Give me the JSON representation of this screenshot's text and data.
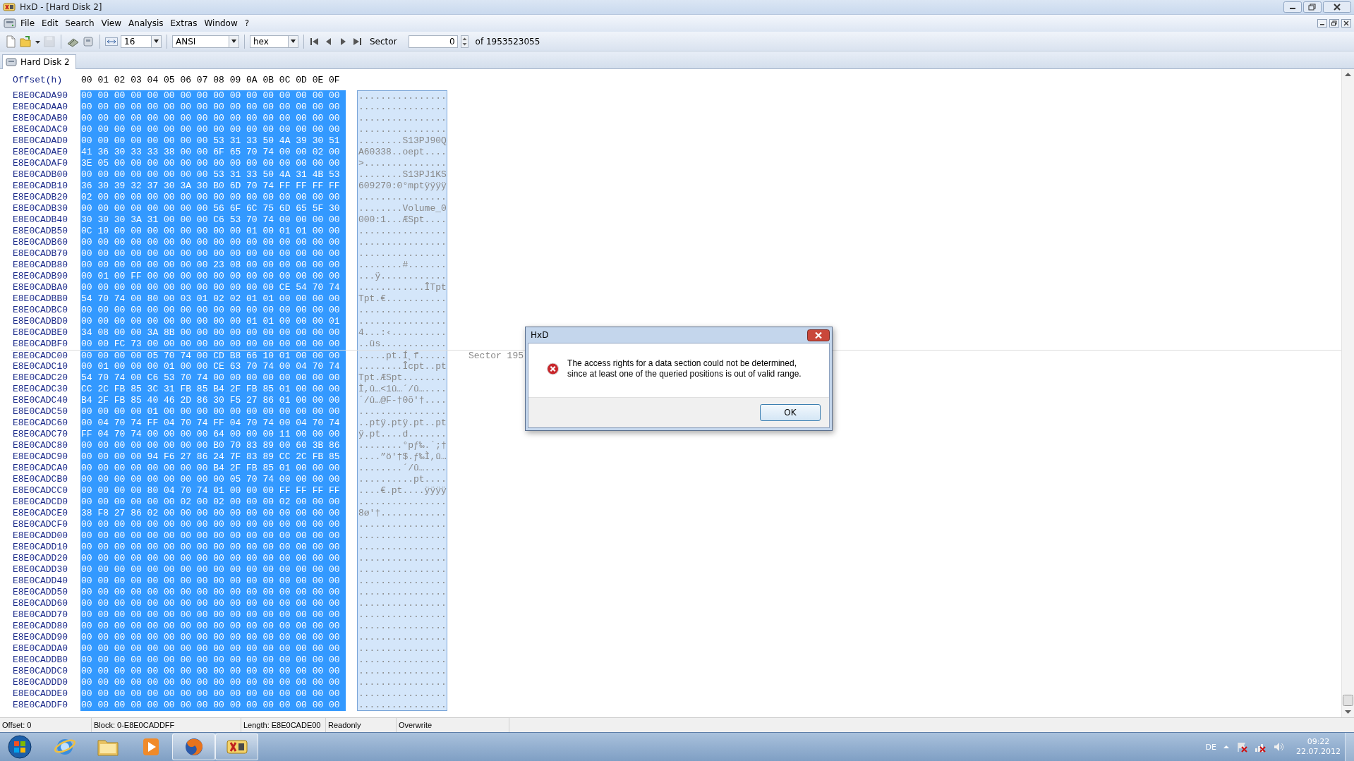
{
  "window": {
    "title": "HxD - [Hard Disk 2]"
  },
  "menu": [
    "File",
    "Edit",
    "Search",
    "View",
    "Analysis",
    "Extras",
    "Window",
    "?"
  ],
  "toolbar": {
    "buttons": [
      {
        "kind": "new",
        "disabled": false
      },
      {
        "kind": "open",
        "disabled": false
      },
      {
        "kind": "save",
        "disabled": true
      },
      {
        "kind": "ram",
        "disabled": false
      },
      {
        "kind": "disk",
        "disabled": false
      }
    ],
    "bytes_per_row": "16",
    "charset": "ANSI",
    "number_base": "hex",
    "nav": [
      {
        "kind": "first"
      },
      {
        "kind": "prev"
      },
      {
        "kind": "next"
      },
      {
        "kind": "last"
      }
    ],
    "sector_label": "Sector",
    "sector_value": "0",
    "sector_total": "of 1953523055"
  },
  "tabs": [
    {
      "label": "Hard Disk 2",
      "selected": true
    }
  ],
  "editor": {
    "offset_heading": "Offset(h)",
    "columns": [
      "00",
      "01",
      "02",
      "03",
      "04",
      "05",
      "06",
      "07",
      "08",
      "09",
      "0A",
      "0B",
      "0C",
      "0D",
      "0E",
      "0F"
    ],
    "hex_selected": true,
    "rows": [
      {
        "offset": "E8E0CADA90",
        "hex": "00 00 00 00 00 00 00 00 00 00 00 00 00 00 00 00",
        "text": "................"
      },
      {
        "offset": "E8E0CADAA0",
        "hex": "00 00 00 00 00 00 00 00 00 00 00 00 00 00 00 00",
        "text": "................"
      },
      {
        "offset": "E8E0CADAB0",
        "hex": "00 00 00 00 00 00 00 00 00 00 00 00 00 00 00 00",
        "text": "................"
      },
      {
        "offset": "E8E0CADAC0",
        "hex": "00 00 00 00 00 00 00 00 00 00 00 00 00 00 00 00",
        "text": "................"
      },
      {
        "offset": "E8E0CADAD0",
        "hex": "00 00 00 00 00 00 00 00 53 31 33 50 4A 39 30 51",
        "text": "........S13PJ90Q"
      },
      {
        "offset": "E8E0CADAE0",
        "hex": "41 36 30 33 33 38 00 00 6F 65 70 74 00 00 02 00",
        "text": "A60338..oept...."
      },
      {
        "offset": "E8E0CADAF0",
        "hex": "3E 05 00 00 00 00 00 00 00 00 00 00 00 00 00 00",
        "text": ">..............."
      },
      {
        "offset": "E8E0CADB00",
        "hex": "00 00 00 00 00 00 00 00 53 31 33 50 4A 31 4B 53",
        "text": "........S13PJ1KS"
      },
      {
        "offset": "E8E0CADB10",
        "hex": "36 30 39 32 37 30 3A 30 B0 6D 70 74 FF FF FF FF",
        "text": "609270:0°mptÿÿÿÿ"
      },
      {
        "offset": "E8E0CADB20",
        "hex": "02 00 00 00 00 00 00 00 00 00 00 00 00 00 00 00",
        "text": "................"
      },
      {
        "offset": "E8E0CADB30",
        "hex": "00 00 00 00 00 00 00 00 56 6F 6C 75 6D 65 5F 30",
        "text": "........Volume_0"
      },
      {
        "offset": "E8E0CADB40",
        "hex": "30 30 30 3A 31 00 00 00 C6 53 70 74 00 00 00 00",
        "text": "000:1...ÆSpt...."
      },
      {
        "offset": "E8E0CADB50",
        "hex": "0C 10 00 00 00 00 00 00 00 00 01 00 01 01 00 00",
        "text": "................"
      },
      {
        "offset": "E8E0CADB60",
        "hex": "00 00 00 00 00 00 00 00 00 00 00 00 00 00 00 00",
        "text": "................"
      },
      {
        "offset": "E8E0CADB70",
        "hex": "00 00 00 00 00 00 00 00 00 00 00 00 00 00 00 00",
        "text": "................"
      },
      {
        "offset": "E8E0CADB80",
        "hex": "00 00 00 00 00 00 00 00 23 08 00 00 00 00 00 00",
        "text": "........#......."
      },
      {
        "offset": "E8E0CADB90",
        "hex": "00 01 00 FF 00 00 00 00 00 00 00 00 00 00 00 00",
        "text": "...ÿ............"
      },
      {
        "offset": "E8E0CADBA0",
        "hex": "00 00 00 00 00 00 00 00 00 00 00 00 CE 54 70 74",
        "text": "............ÎTpt"
      },
      {
        "offset": "E8E0CADBB0",
        "hex": "54 70 74 00 80 00 03 01 02 02 01 01 00 00 00 00",
        "text": "Tpt.€..........."
      },
      {
        "offset": "E8E0CADBC0",
        "hex": "00 00 00 00 00 00 00 00 00 00 00 00 00 00 00 00",
        "text": "................"
      },
      {
        "offset": "E8E0CADBD0",
        "hex": "00 00 00 00 00 00 00 00 00 00 01 01 00 00 00 01",
        "text": "................"
      },
      {
        "offset": "E8E0CADBE0",
        "hex": "34 08 00 00 3A 8B 00 00 00 00 00 00 00 00 00 00",
        "text": "4...:‹.........."
      },
      {
        "offset": "E8E0CADBF0",
        "hex": "00 00 FC 73 00 00 00 00 00 00 00 00 00 00 00 00",
        "text": "..üs............"
      },
      {
        "offset": "E8E0CADC00",
        "hex": "00 00 00 00 05 70 74 00 CD B8 66 10 01 00 00 00",
        "text": ".....pt.Í¸f.....",
        "sector_label": "Sector 195"
      },
      {
        "offset": "E8E0CADC10",
        "hex": "00 01 00 00 00 01 00 00 CE 63 70 74 00 04 70 74",
        "text": "........Îcpt..pt"
      },
      {
        "offset": "E8E0CADC20",
        "hex": "54 70 74 00 C6 53 70 74 00 00 00 00 00 00 00 00",
        "text": "Tpt.ÆSpt........"
      },
      {
        "offset": "E8E0CADC30",
        "hex": "CC 2C FB 85 3C 31 FB 85 B4 2F FB 85 01 00 00 00",
        "text": "Ì,û…<1û…´/û…...."
      },
      {
        "offset": "E8E0CADC40",
        "hex": "B4 2F FB 85 40 46 2D 86 30 F5 27 86 01 00 00 00",
        "text": "´/û…@F-†0õ'†...."
      },
      {
        "offset": "E8E0CADC50",
        "hex": "00 00 00 00 01 00 00 00 00 00 00 00 00 00 00 00",
        "text": "................"
      },
      {
        "offset": "E8E0CADC60",
        "hex": "00 04 70 74 FF 04 70 74 FF 04 70 74 00 04 70 74",
        "text": "..ptÿ.ptÿ.pt..pt"
      },
      {
        "offset": "E8E0CADC70",
        "hex": "FF 04 70 74 00 00 00 00 64 00 00 00 11 00 00 00",
        "text": "ÿ.pt....d......."
      },
      {
        "offset": "E8E0CADC80",
        "hex": "00 00 00 00 00 00 00 00 B0 70 83 89 00 60 3B 86",
        "text": "........°pƒ‰.`;†"
      },
      {
        "offset": "E8E0CADC90",
        "hex": "00 00 00 00 94 F6 27 86 24 7F 83 89 CC 2C FB 85",
        "text": "....”ö'†$.ƒ‰Ì,û…"
      },
      {
        "offset": "E8E0CADCA0",
        "hex": "00 00 00 00 00 00 00 00 B4 2F FB 85 01 00 00 00",
        "text": "........´/û…...."
      },
      {
        "offset": "E8E0CADCB0",
        "hex": "00 00 00 00 00 00 00 00 00 05 70 74 00 00 00 00",
        "text": "..........pt...."
      },
      {
        "offset": "E8E0CADCC0",
        "hex": "00 00 00 00 80 04 70 74 01 00 00 00 FF FF FF FF",
        "text": "....€.pt....ÿÿÿÿ"
      },
      {
        "offset": "E8E0CADCD0",
        "hex": "00 00 00 00 00 00 02 00 02 00 00 00 02 00 00 00",
        "text": "................"
      },
      {
        "offset": "E8E0CADCE0",
        "hex": "38 F8 27 86 02 00 00 00 00 00 00 00 00 00 00 00",
        "text": "8ø'†............"
      },
      {
        "offset": "E8E0CADCF0",
        "hex": "00 00 00 00 00 00 00 00 00 00 00 00 00 00 00 00",
        "text": "................"
      },
      {
        "offset": "E8E0CADD00",
        "hex": "00 00 00 00 00 00 00 00 00 00 00 00 00 00 00 00",
        "text": "................"
      },
      {
        "offset": "E8E0CADD10",
        "hex": "00 00 00 00 00 00 00 00 00 00 00 00 00 00 00 00",
        "text": "................"
      },
      {
        "offset": "E8E0CADD20",
        "hex": "00 00 00 00 00 00 00 00 00 00 00 00 00 00 00 00",
        "text": "................"
      },
      {
        "offset": "E8E0CADD30",
        "hex": "00 00 00 00 00 00 00 00 00 00 00 00 00 00 00 00",
        "text": "................"
      },
      {
        "offset": "E8E0CADD40",
        "hex": "00 00 00 00 00 00 00 00 00 00 00 00 00 00 00 00",
        "text": "................"
      },
      {
        "offset": "E8E0CADD50",
        "hex": "00 00 00 00 00 00 00 00 00 00 00 00 00 00 00 00",
        "text": "................"
      },
      {
        "offset": "E8E0CADD60",
        "hex": "00 00 00 00 00 00 00 00 00 00 00 00 00 00 00 00",
        "text": "................"
      },
      {
        "offset": "E8E0CADD70",
        "hex": "00 00 00 00 00 00 00 00 00 00 00 00 00 00 00 00",
        "text": "................"
      },
      {
        "offset": "E8E0CADD80",
        "hex": "00 00 00 00 00 00 00 00 00 00 00 00 00 00 00 00",
        "text": "................"
      },
      {
        "offset": "E8E0CADD90",
        "hex": "00 00 00 00 00 00 00 00 00 00 00 00 00 00 00 00",
        "text": "................"
      },
      {
        "offset": "E8E0CADDA0",
        "hex": "00 00 00 00 00 00 00 00 00 00 00 00 00 00 00 00",
        "text": "................"
      },
      {
        "offset": "E8E0CADDB0",
        "hex": "00 00 00 00 00 00 00 00 00 00 00 00 00 00 00 00",
        "text": "................"
      },
      {
        "offset": "E8E0CADDC0",
        "hex": "00 00 00 00 00 00 00 00 00 00 00 00 00 00 00 00",
        "text": "................"
      },
      {
        "offset": "E8E0CADDD0",
        "hex": "00 00 00 00 00 00 00 00 00 00 00 00 00 00 00 00",
        "text": "................"
      },
      {
        "offset": "E8E0CADDE0",
        "hex": "00 00 00 00 00 00 00 00 00 00 00 00 00 00 00 00",
        "text": "................"
      },
      {
        "offset": "E8E0CADDF0",
        "hex": "00 00 00 00 00 00 00 00 00 00 00 00 00 00 00 00",
        "text": "................"
      }
    ]
  },
  "status_bar": [
    "Offset: 0",
    "Block: 0-E8E0CADDFF",
    "Length: E8E0CADE00",
    "Readonly",
    "Overwrite"
  ],
  "dialog": {
    "title": "HxD",
    "message": "The access rights for a data section could not be determined, since at least one of the queried positions is out of valid range.",
    "button": "OK"
  },
  "taskbar": {
    "apps": [
      {
        "kind": "ie",
        "running": false
      },
      {
        "kind": "folder",
        "running": false
      },
      {
        "kind": "media",
        "running": false
      },
      {
        "kind": "firefox",
        "running": true
      },
      {
        "kind": "hxd",
        "running": true
      }
    ],
    "language": "DE",
    "time": "09:22",
    "date": "22.07.2012"
  }
}
